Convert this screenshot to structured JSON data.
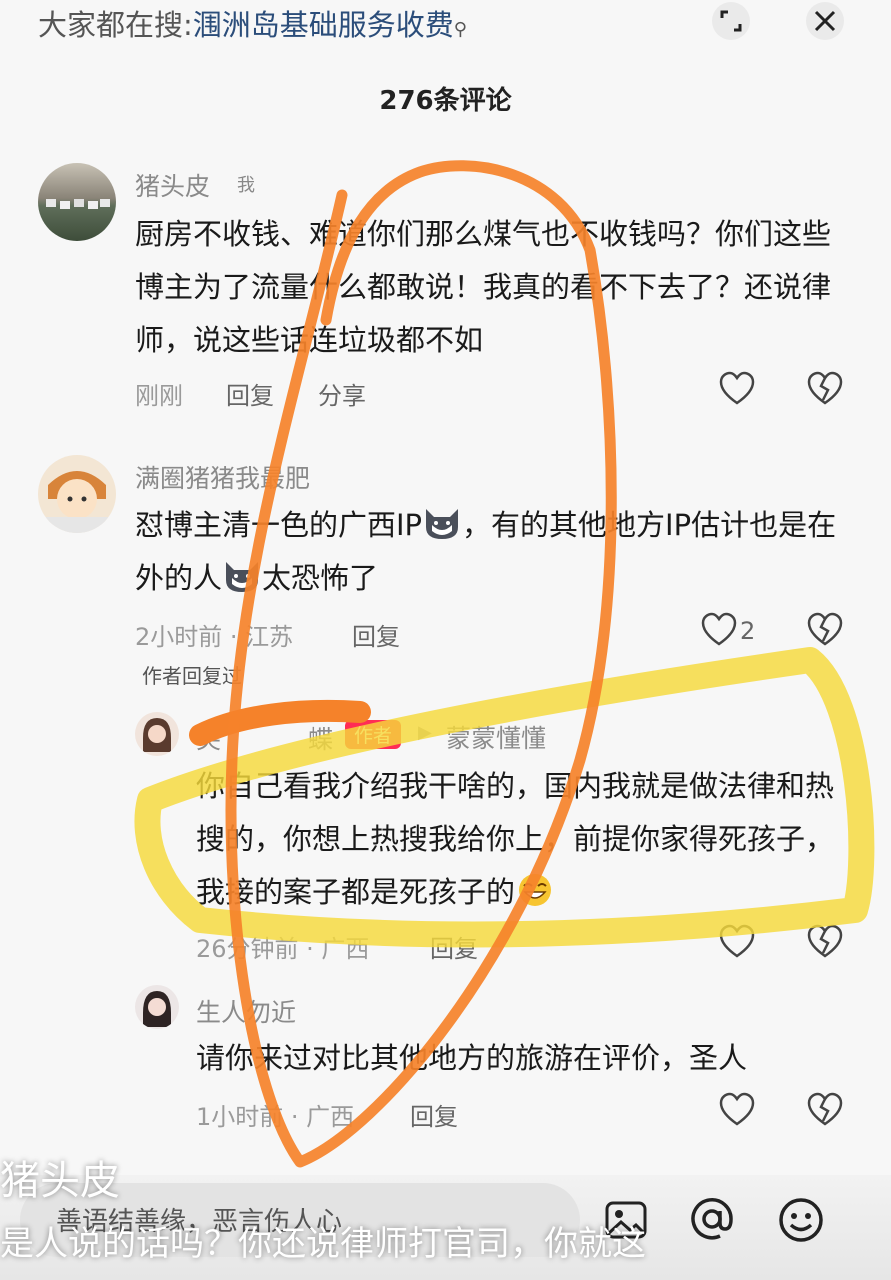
{
  "header": {
    "search_label": "大家都在搜:",
    "search_term": "涠洲岛基础服务收费",
    "comment_count": "276条评论"
  },
  "comments": [
    {
      "username": "猪头皮",
      "self_tag": "我",
      "text": "厨房不收钱、难道你们那么煤气也不收钱吗？你们这些博主为了流量什么都敢说！我真的看不下去了？还说律师，说这些话连垃圾都不如",
      "time": "刚刚",
      "reply": "回复",
      "share": "分享"
    },
    {
      "username": "满圈猪猪我最肥",
      "text_part1": "怼博主清一色的广西IP",
      "text_part2": "，有的其他地方IP估计也是在外的人",
      "text_part3": "太恐怖了",
      "time": "2小时前 · 江苏",
      "reply": "回复",
      "like_count": "2",
      "author_replied": "作者回复过"
    },
    {
      "username": "尖",
      "username_tail": "蝶",
      "author_tag": "作者",
      "reply_to": "蒙蒙懂懂",
      "text": "你自己看我介绍我干啥的，国内我就是做法律和热搜的，你想上热搜我给你上，前提你家得死孩子，我接的案子都是死孩子的",
      "time": "26分钟前 · 广西",
      "reply": "回复"
    },
    {
      "username": "生人勿近",
      "text": "请你来过对比其他地方的旅游在评价，圣人",
      "time": "1小时前 · 广西",
      "reply": "回复"
    }
  ],
  "input": {
    "placeholder": "善语结善缘，恶言伤人心"
  },
  "video_overlay": {
    "name": "猪头皮",
    "caption": "是人说的话吗？你还说律师打官司，你就这"
  },
  "colors": {
    "accent": "#ff2c55",
    "orange_annotation": "#f5822a",
    "yellow_highlight": "#f5d93a",
    "search_term": "#2b4d7a"
  }
}
